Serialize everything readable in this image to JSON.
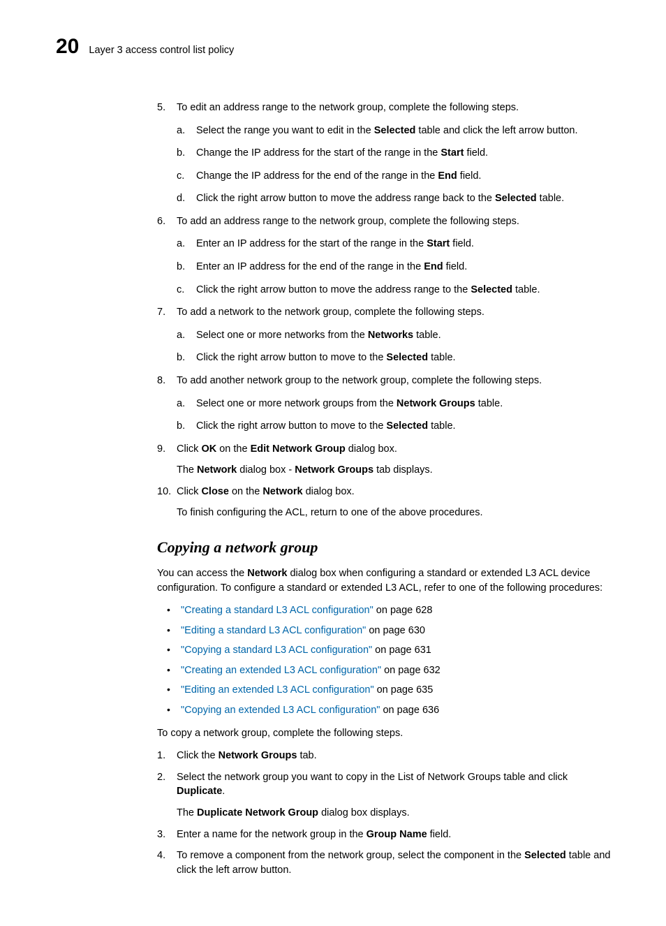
{
  "header": {
    "chapter_number": "20",
    "title": "Layer 3 access control list policy"
  },
  "steps": [
    {
      "num": "5.",
      "text": "To edit an address range to the network group, complete the following steps.",
      "sub": [
        {
          "lett": "a.",
          "parts": [
            {
              "t": "Select the range you want to edit in the "
            },
            {
              "t": "Selected",
              "b": true
            },
            {
              "t": " table and click the left arrow button."
            }
          ]
        },
        {
          "lett": "b.",
          "parts": [
            {
              "t": "Change the IP address for the start of the range in the "
            },
            {
              "t": "Start",
              "b": true
            },
            {
              "t": " field."
            }
          ]
        },
        {
          "lett": "c.",
          "parts": [
            {
              "t": "Change the IP address for the end of the range in the "
            },
            {
              "t": "End",
              "b": true
            },
            {
              "t": " field."
            }
          ]
        },
        {
          "lett": "d.",
          "parts": [
            {
              "t": "Click the right arrow button to move the address range back to the "
            },
            {
              "t": "Selected",
              "b": true
            },
            {
              "t": " table."
            }
          ]
        }
      ]
    },
    {
      "num": "6.",
      "text": "To add an address range to the network group, complete the following steps.",
      "sub": [
        {
          "lett": "a.",
          "parts": [
            {
              "t": "Enter an IP address for the start of the range in the "
            },
            {
              "t": "Start",
              "b": true
            },
            {
              "t": " field."
            }
          ]
        },
        {
          "lett": "b.",
          "parts": [
            {
              "t": "Enter an IP address for the end of the range in the "
            },
            {
              "t": "End",
              "b": true
            },
            {
              "t": " field."
            }
          ]
        },
        {
          "lett": "c.",
          "parts": [
            {
              "t": "Click the right arrow button to move the address range to the "
            },
            {
              "t": "Selected",
              "b": true
            },
            {
              "t": " table."
            }
          ]
        }
      ]
    },
    {
      "num": "7.",
      "text": "To add a network to the network group, complete the following steps.",
      "sub": [
        {
          "lett": "a.",
          "parts": [
            {
              "t": "Select one or more networks from the "
            },
            {
              "t": "Networks",
              "b": true
            },
            {
              "t": " table."
            }
          ]
        },
        {
          "lett": "b.",
          "parts": [
            {
              "t": "Click the right arrow button to move to the "
            },
            {
              "t": "Selected",
              "b": true
            },
            {
              "t": " table."
            }
          ]
        }
      ]
    },
    {
      "num": "8.",
      "text": "To add another network group to the network group, complete the following steps.",
      "sub": [
        {
          "lett": "a.",
          "parts": [
            {
              "t": "Select one or more network groups from the "
            },
            {
              "t": "Network Groups",
              "b": true
            },
            {
              "t": " table."
            }
          ]
        },
        {
          "lett": "b.",
          "parts": [
            {
              "t": "Click the right arrow button to move to the "
            },
            {
              "t": "Selected",
              "b": true
            },
            {
              "t": " table."
            }
          ]
        }
      ]
    },
    {
      "num": "9.",
      "parts": [
        {
          "t": "Click "
        },
        {
          "t": "OK",
          "b": true
        },
        {
          "t": " on the "
        },
        {
          "t": "Edit Network Group",
          "b": true
        },
        {
          "t": " dialog box."
        }
      ],
      "follow_parts": [
        {
          "t": "The "
        },
        {
          "t": "Network",
          "b": true
        },
        {
          "t": " dialog box - "
        },
        {
          "t": "Network Groups",
          "b": true
        },
        {
          "t": " tab displays."
        }
      ]
    },
    {
      "num": "10.",
      "parts": [
        {
          "t": "Click "
        },
        {
          "t": "Close",
          "b": true
        },
        {
          "t": " on the "
        },
        {
          "t": "Network",
          "b": true
        },
        {
          "t": " dialog box."
        }
      ],
      "follow_text": "To finish configuring the ACL, return to one of the above procedures."
    }
  ],
  "section": {
    "heading": "Copying a network group",
    "intro_parts": [
      {
        "t": "You can access the "
      },
      {
        "t": "Network",
        "b": true
      },
      {
        "t": " dialog box when configuring a standard or extended L3 ACL device configuration. To configure a standard or extended L3 ACL, refer to one of the following procedures:"
      }
    ],
    "links": [
      {
        "label": "\"Creating a standard L3 ACL configuration\"",
        "suffix": " on page 628"
      },
      {
        "label": "\"Editing a standard L3 ACL configuration\"",
        "suffix": " on page 630"
      },
      {
        "label": "\"Copying a standard L3 ACL configuration\"",
        "suffix": " on page 631"
      },
      {
        "label": "\"Creating an extended L3 ACL configuration\"",
        "suffix": " on page 632"
      },
      {
        "label": "\"Editing an extended L3 ACL configuration\"",
        "suffix": " on page 635"
      },
      {
        "label": "\"Copying an extended L3 ACL configuration\"",
        "suffix": " on page 636"
      }
    ],
    "lead": "To copy a network group, complete the following steps.",
    "steps": [
      {
        "num": "1.",
        "parts": [
          {
            "t": "Click the "
          },
          {
            "t": "Network Groups",
            "b": true
          },
          {
            "t": " tab."
          }
        ]
      },
      {
        "num": "2.",
        "parts": [
          {
            "t": "Select the network group you want to copy in the List of Network Groups table and click "
          },
          {
            "t": "Duplicate",
            "b": true
          },
          {
            "t": "."
          }
        ],
        "follow_parts": [
          {
            "t": "The "
          },
          {
            "t": "Duplicate Network Group",
            "b": true
          },
          {
            "t": " dialog box displays."
          }
        ]
      },
      {
        "num": "3.",
        "parts": [
          {
            "t": "Enter a name for the network group in the "
          },
          {
            "t": "Group Name",
            "b": true
          },
          {
            "t": " field."
          }
        ]
      },
      {
        "num": "4.",
        "parts": [
          {
            "t": "To remove a component from the network group, select the component in the "
          },
          {
            "t": "Selected",
            "b": true
          },
          {
            "t": " table and click the left arrow button."
          }
        ]
      }
    ]
  }
}
